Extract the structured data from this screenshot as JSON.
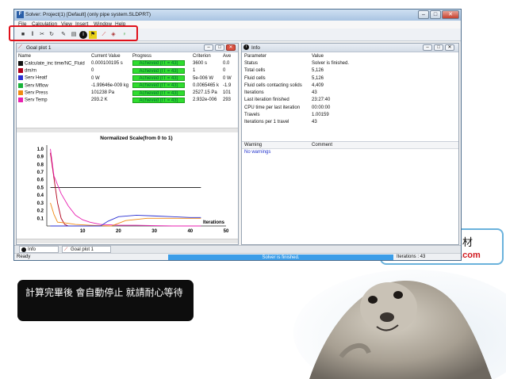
{
  "window": {
    "title": "Solver: Project(1) [Default] (only pipe system.SLDPRT)",
    "icon_letter": "F"
  },
  "menu": [
    "File",
    "Calculation",
    "View",
    "Insert",
    "Window",
    "Help"
  ],
  "toolbar_icons": [
    "stop-icon",
    "pause-icon",
    "insert-icon",
    "refresh-icon",
    "pin-icon",
    "sheet-icon",
    "info-icon",
    "flag-icon",
    "goal-plot-icon",
    "preview-icon",
    "light-bulb-icon"
  ],
  "goal_pane": {
    "title": "Goal plot 1",
    "headers": [
      "Name",
      "Current Value",
      "Progress",
      "Criterion",
      "Ave"
    ],
    "rows": [
      {
        "color": "#111111",
        "name": "Calculate_inc time/NC_Fluid",
        "value": "0.000100195 s",
        "progress": "Achieved (IT = 43)",
        "criterion": "3600 s",
        "ave": "0.0"
      },
      {
        "color": "#b0001a",
        "name": "dm/m",
        "value": "0",
        "progress": "Achieved (IT = 43)",
        "criterion": "1",
        "ave": "0"
      },
      {
        "color": "#2a2fd1",
        "name": "Serv Heatf",
        "value": "0 W",
        "progress": "Achieved (IT = 43)",
        "criterion": "5e-006 W",
        "ave": "0 W"
      },
      {
        "color": "#18b33a",
        "name": "Serv Mflow",
        "value": "-1.99646e-009 kg",
        "progress": "Achieved (IT = 43)",
        "criterion": "0.0065465 k",
        "ave": "-1.9"
      },
      {
        "color": "#f08a12",
        "name": "Serv Press",
        "value": "101238 Pa",
        "progress": "Achieved (IT = 43)",
        "criterion": "2527.15 Pa",
        "ave": "101"
      },
      {
        "color": "#e81fb0",
        "name": "Serv Temp",
        "value": "293.2 K",
        "progress": "Achieved (IT = 43)",
        "criterion": "2.932e-006",
        "ave": "293"
      }
    ]
  },
  "chart_data": {
    "type": "line",
    "title": "Normalized Scale(from 0 to 1)",
    "xlabel": "Iterations",
    "ylabel": "",
    "xlim": [
      0,
      50
    ],
    "ylim": [
      0,
      1.05
    ],
    "xticks": [
      10,
      20,
      30,
      40,
      50
    ],
    "yticks": [
      0.1,
      0.2,
      0.3,
      0.4,
      0.5,
      0.6,
      0.7,
      0.8,
      0.9,
      1.0
    ],
    "series": [
      {
        "color": "#111111",
        "x": [
          1,
          2,
          3,
          43
        ],
        "y": [
          0.5,
          0.5,
          0.5,
          0.5
        ]
      },
      {
        "color": "#b0001a",
        "x": [
          1,
          2,
          3,
          4,
          5,
          6,
          7
        ],
        "y": [
          0.95,
          0.62,
          0.3,
          0.1,
          0.02,
          0,
          0
        ]
      },
      {
        "color": "#e81fb0",
        "x": [
          1,
          2,
          4,
          6,
          8,
          10,
          12,
          15,
          20,
          25,
          30,
          35,
          43
        ],
        "y": [
          1.0,
          0.65,
          0.42,
          0.26,
          0.14,
          0.08,
          0.05,
          0.02,
          0.01,
          0.01,
          0.005,
          0,
          0
        ]
      },
      {
        "color": "#f08a12",
        "x": [
          1,
          2,
          3,
          5,
          8,
          12,
          18,
          22,
          28,
          35,
          43
        ],
        "y": [
          0.3,
          0.15,
          0.05,
          0.04,
          0.02,
          0.01,
          0.0,
          0.07,
          0.1,
          0.1,
          0.1
        ]
      },
      {
        "color": "#2a2fd1",
        "x": [
          1,
          15,
          17,
          20,
          25,
          30,
          35,
          40,
          43
        ],
        "y": [
          0,
          0,
          0.06,
          0.12,
          0.14,
          0.13,
          0.12,
          0.11,
          0.11
        ]
      }
    ]
  },
  "info_pane": {
    "title": "Info",
    "headers": [
      "Parameter",
      "Value"
    ],
    "rows": [
      [
        "Status",
        "Solver is finished."
      ],
      [
        "Total cells",
        "5,126"
      ],
      [
        "Fluid cells",
        "5,126"
      ],
      [
        "Fluid cells contacting solids",
        "4,409"
      ],
      [
        "Iterations",
        "43"
      ],
      [
        "Last iteration finished",
        "23:27:40"
      ],
      [
        "CPU time per last iteration",
        "00:00:00"
      ],
      [
        "Travels",
        "1.00159"
      ],
      [
        "Iterations per 1 travel",
        "43"
      ]
    ],
    "warn_headers": [
      "Warning",
      "Comment"
    ],
    "warn_text": "No warnings"
  },
  "tabs": [
    "Info",
    "Goal plot 1"
  ],
  "status": {
    "left": "Ready",
    "progress": "Solver is finished.",
    "right": "Iterations : 43"
  },
  "callout": "計算完畢後 會自動停止 就請耐心等待",
  "bubble": {
    "line1": "材",
    "line2": "il.com"
  }
}
